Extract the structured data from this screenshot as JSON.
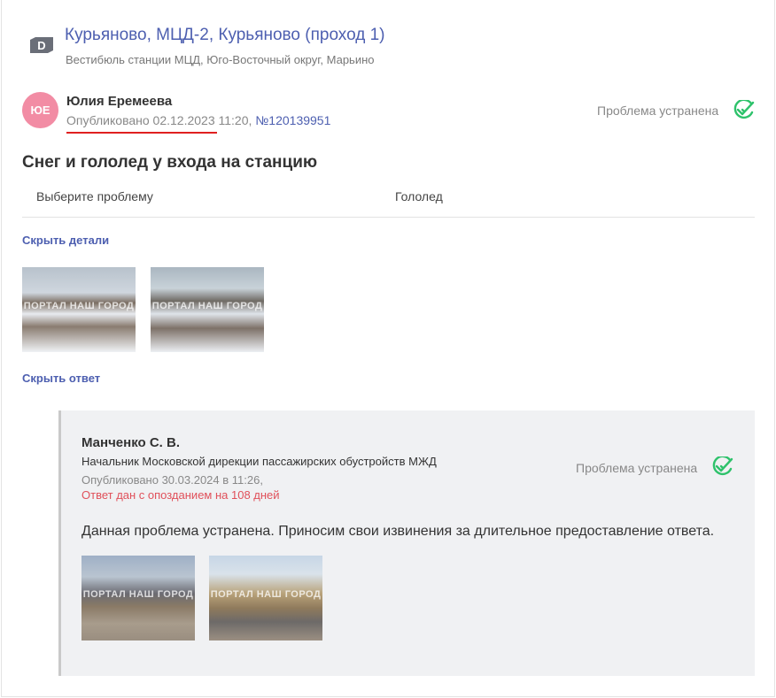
{
  "object": {
    "icon": "d-tag-icon",
    "title": "Курьяново, МЦД-2, Курьяново (проход 1)",
    "subtitle": "Вестибюль станции МЦД, Юго-Восточный округ, Марьино"
  },
  "post": {
    "avatar_initials": "ЮЕ",
    "author": "Юлия Еремеева",
    "published_prefix": "Опубликовано 02.12.2023 11:20, ",
    "number": "№120139951",
    "status": "Проблема устранена",
    "title": "Снег и гололед у входа на станцию",
    "param_label": "Выберите проблему",
    "param_value": "Гололед",
    "hide_details": "Скрыть детали",
    "photo_watermark": "ПОРТАЛ НАШ ГОРОД",
    "hide_answer": "Скрыть ответ"
  },
  "answer": {
    "name": "Манченко С. В.",
    "role": "Начальник Московской дирекции пассажирских обустройств МЖД",
    "date": "Опубликовано 30.03.2024 в 11:26,",
    "late": "Ответ дан с опозданием на 108 дней",
    "status": "Проблема устранена",
    "text": "Данная проблема устранена. Приносим свои извинения за длительное предоставление ответа.",
    "photo_watermark": "ПОРТАЛ НАШ ГОРОД"
  },
  "colors": {
    "accent": "#4d5fb0",
    "avatar": "#f28ca4",
    "status_check": "#2ec26b",
    "late": "#e0505a",
    "underline": "#e02020"
  }
}
